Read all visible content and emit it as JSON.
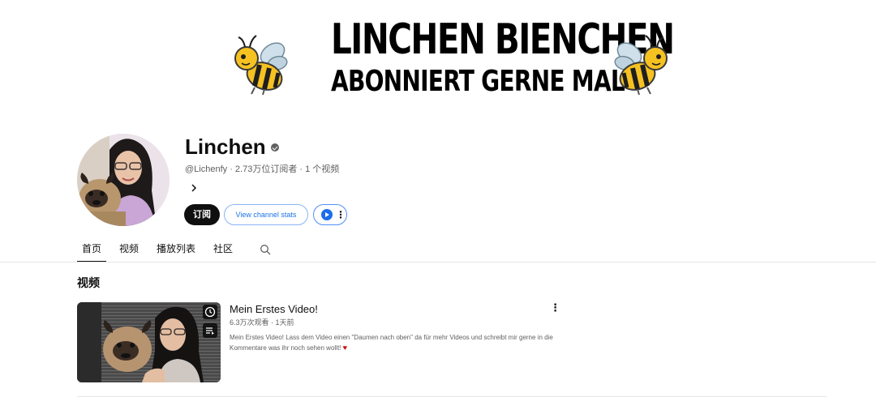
{
  "banner": {
    "title": "LINCHEN BIENCHEN",
    "subtitle": "ABONNIERT GERNE MAL",
    "left_icon": "bee-icon",
    "right_icon": "bee-icon"
  },
  "channel": {
    "name": "Linchen",
    "verified_icon": "verified-check-icon",
    "meta": "@Lichenfy · 2.73万位订阅者 · 1 个视频",
    "more_icon": "chevron-right-icon",
    "subscribe_label": "订阅",
    "stats_label": "View channel stats",
    "extension_icon": "play-circle-icon",
    "extension_more_icon": "more-vert-icon"
  },
  "tabs": [
    {
      "label": "首页",
      "active": true
    },
    {
      "label": "视频",
      "active": false
    },
    {
      "label": "播放列表",
      "active": false
    },
    {
      "label": "社区",
      "active": false
    }
  ],
  "tabs_search_icon": "search-icon",
  "section": {
    "title": "视频"
  },
  "video": {
    "title": "Mein Erstes Video!",
    "meta": "6.3万次观看 · 1天前",
    "description": "Mein Erstes Video! Lass dem Video einen \"Daumen nach oben\" da für mehr Videos und schreibt mir gerne in die Kommentare was ihr noch sehen wollt!",
    "heart": "♥",
    "more_icon": "more-vert-icon",
    "watch_later_icon": "clock-icon",
    "add_queue_icon": "playlist-add-icon"
  },
  "colors": {
    "text_primary": "#0f0f0f",
    "text_secondary": "#606060",
    "subscribe_bg": "#0f0f0f",
    "link_blue": "#1a73e8",
    "heart_red": "#d60000"
  }
}
